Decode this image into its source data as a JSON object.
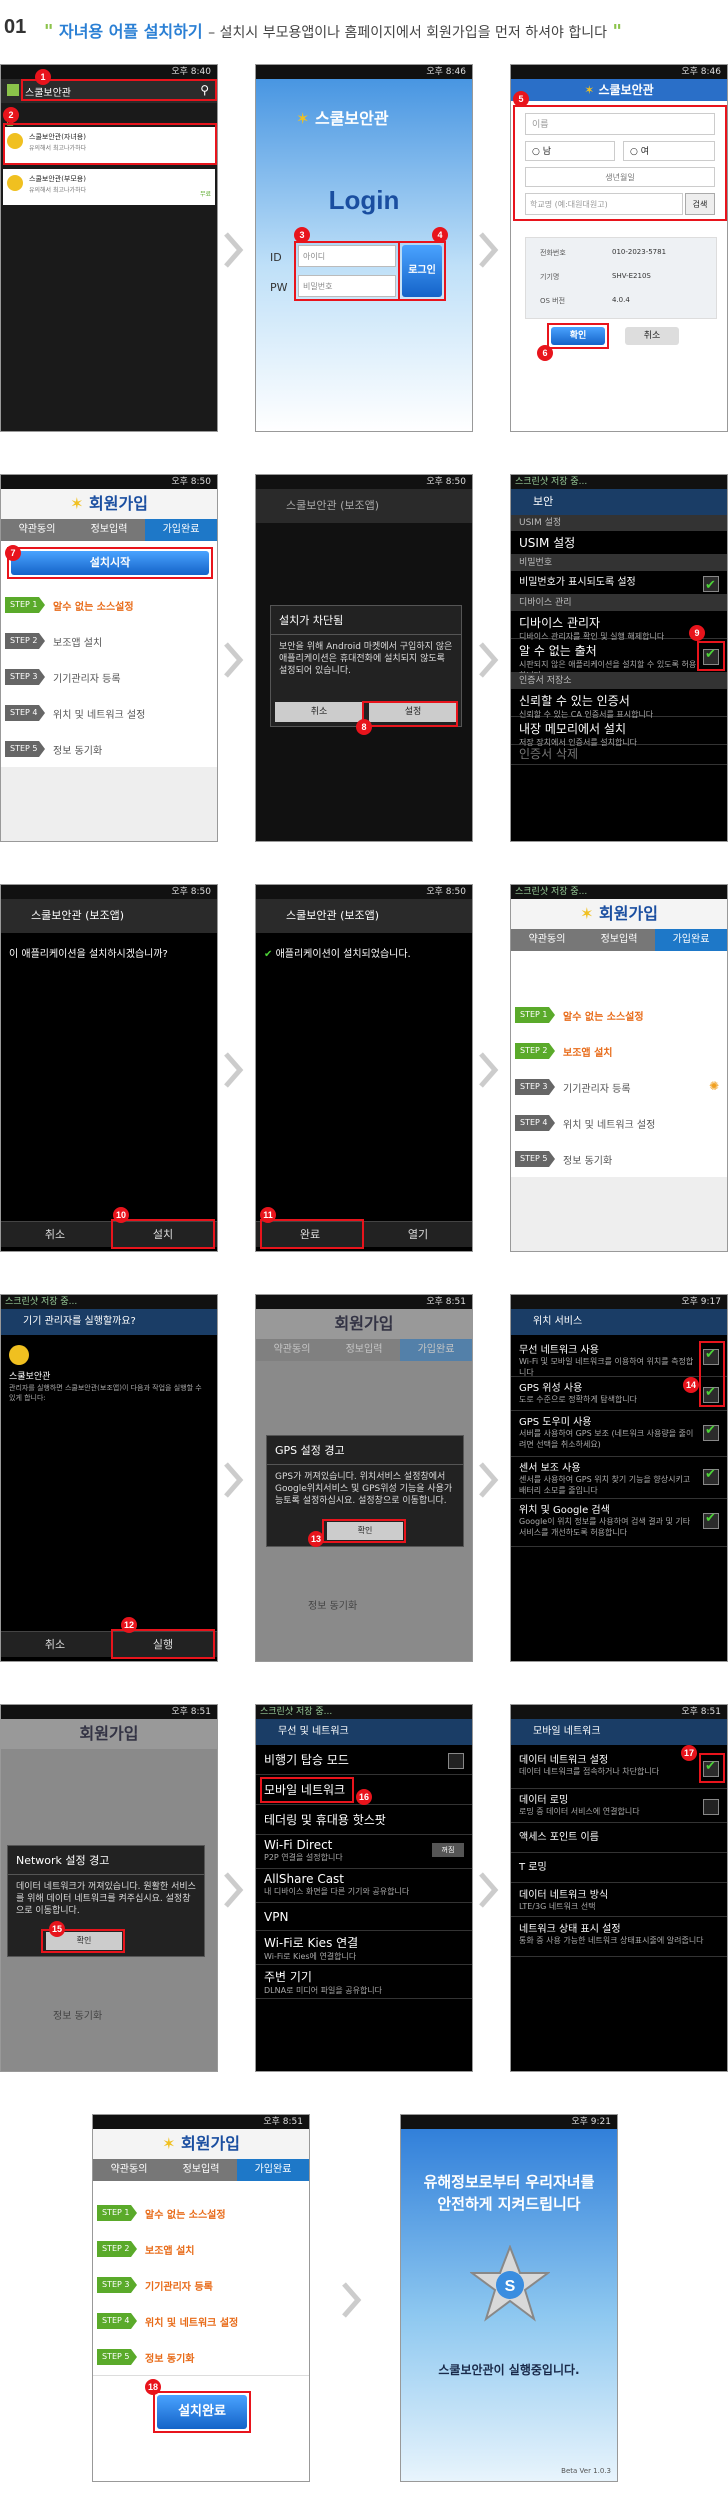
{
  "header": {
    "num": "01",
    "title": "자녀용 어플 설치하기",
    "sub": "– 설치시 부모용앱이나 홈페이지에서 회원가입을 먼저 하셔야 합니다"
  },
  "status": {
    "t1": "오후 8:40",
    "t2": "오후 8:46",
    "t3": "오후 8:46",
    "t4": "오후 8:50",
    "t5": "오후 8:50",
    "t6": "오후 8:50",
    "t7": "오후 8:50",
    "t8": "오후 8:50",
    "t9": "오후 8:51",
    "t10": "오후 8:51",
    "t11": "오후 9:17",
    "t12": "오후 8:51",
    "t13": "오후 8:51",
    "t14": "오후 8:51",
    "t15": "오후 9:21"
  },
  "screens": {
    "s1": {
      "search": "스쿨보안관",
      "section": "앱",
      "app1": "스쿨보안관(자녀용)",
      "app1_sub": "유의해서 최고나가하다",
      "app2": "스쿨보안관(부모용)",
      "app2_sub": "유의해서 최고나가하다",
      "free": "무료"
    },
    "s2": {
      "brand": "스쿨보안관",
      "login": "Login",
      "id_label": "ID",
      "pw_label": "PW",
      "id_ph": "아이디",
      "pw_ph": "비밀번호",
      "login_btn": "로그인"
    },
    "s3": {
      "brand": "스쿨보안관",
      "name_ph": "이름",
      "male": "남",
      "female": "여",
      "birth": "생년월일",
      "school_ph": "학교명  (예:대원대원고)",
      "search_btn": "검색",
      "phone_k": "전화번호",
      "phone_v": "010-2023-5781",
      "model_k": "기기명",
      "model_v": "SHV-E210S",
      "os_k": "OS 버전",
      "os_v": "4.0.4",
      "ok": "확인",
      "cancel": "취소"
    },
    "s4": {
      "title": "회원가입",
      "tabs": [
        "약관동의",
        "정보입력",
        "가입완료"
      ],
      "install_btn": "설치시작",
      "steps": [
        {
          "tag": "STEP 1",
          "label": "알수 없는 소스설정"
        },
        {
          "tag": "STEP 2",
          "label": "보조앱 설치"
        },
        {
          "tag": "STEP 3",
          "label": "기기관리자 등록"
        },
        {
          "tag": "STEP 4",
          "label": "위치 및 네트워크 설정"
        },
        {
          "tag": "STEP 5",
          "label": "정보 동기화"
        }
      ]
    },
    "s5": {
      "app": "스쿨보안관 (보조앱)",
      "dlg_title": "설치가 차단됨",
      "dlg_body": "보안을 위해 Android 마켓에서 구입하지 않은 애플리케이션은 휴대전화에 설치되지 않도록 설정되어 있습니다.",
      "cancel": "취소",
      "settings": "설정"
    },
    "s6": {
      "title": "보안",
      "usim_sec": "USIM 설정",
      "usim": "USIM 설정",
      "pw_sec": "비밀번호",
      "pw_show": "비밀번호가 표시되도록 설정",
      "dev_sec": "디바이스 관리",
      "dev_admin": "디바이스 관리자",
      "dev_admin_d": "디바이스 관리자를 확인 및 실행 해제합니다",
      "unknown": "알 수 없는 출처",
      "unknown_d": "시판되지 않은 애플리케이션을 설치할 수 있도록 허용합니다",
      "cred_sec": "인증서 저장소",
      "trusted": "신뢰할 수 있는 인증서",
      "trusted_d": "신뢰할 수 있는 CA 인증서를 표시합니다",
      "mem": "내장 메모리에서 설치",
      "mem_d": "저장 장치에서 인증서를 설치합니다",
      "del": "인증서 삭제"
    },
    "s7": {
      "app": "스쿨보안관 (보조앱)",
      "q": "이 애플리케이션을 설치하시겠습니까?",
      "cancel": "취소",
      "install": "설치"
    },
    "s8": {
      "app": "스쿨보안관 (보조앱)",
      "done_msg": "애플리케이션이 설치되었습니다.",
      "done": "완료",
      "open": "열기"
    },
    "s9": {
      "title": "회원가입",
      "tabs": [
        "약관동의",
        "정보입력",
        "가입완료"
      ]
    },
    "s10": {
      "title": "기기 관리자를 실행할까요?",
      "app": "스쿨보안관",
      "desc": "관리자를 실행하면 스쿨보안관(보조앱)이 다음과 작업을 실행할 수 있게 합니다:",
      "cancel": "취소",
      "run": "실행"
    },
    "s11": {
      "dlg_title": "GPS 설정 경고",
      "dlg_body": "GPS가 꺼져있습니다. 위치서비스 설정창에서 Google위치서비스 및 GPS위성 기능을 사용가능토록 설정하십시요. 설정창으로 이동합니다.",
      "ok": "확인",
      "step5": "정보 동기화"
    },
    "s12": {
      "title": "위치 서비스",
      "wifi": "무선 네트워크 사용",
      "wifi_d": "Wi-Fi 및 모바일 네트워크를 이용하여 위치를 측정합니다",
      "gps": "GPS 위성 사용",
      "gps_d": "도로 수준으로 정확하게 탐색합니다",
      "agps": "GPS 도우미 사용",
      "agps_d": "서버를 사용하여 GPS 보조 (네트워크 사용량을 줄이려면 선택을 취소하세요)",
      "sensor": "센서 보조 사용",
      "sensor_d": "센서를 사용하여 GPS 위치 찾기 기능을 향상시키고 배터리 소모를 줄입니다",
      "google": "위치 및 Google 검색",
      "google_d": "Google이 위치 정보를 사용하여 검색 결과 및 기타 서비스를 개선하도록 허용합니다"
    },
    "s13": {
      "dlg_title": "Network 설정 경고",
      "dlg_body": "데이터 네트워크가 꺼져있습니다. 원활한 서비스를 위해 데이터 네트워크를 켜주십시요. 설정창으로 이동합니다.",
      "ok": "확인",
      "step5": "정보 동기화"
    },
    "s14": {
      "title": "무선 및 네트워크",
      "air": "비행기 탑승 모드",
      "mobile": "모바일 네트워크",
      "tether": "테더링 및 휴대용 핫스팟",
      "wfd": "Wi-Fi Direct",
      "wfd_d": "P2P 연결을 설정합니다",
      "wfd_state": "꺼짐",
      "allshare": "AllShare Cast",
      "allshare_d": "내 디바이스 화면을 다른 기기와 공유합니다",
      "vpn": "VPN",
      "kies": "Wi-Fi로 Kies 연결",
      "kies_d": "Wi-Fi로 Kies에 연결합니다",
      "nearby": "주변 기기",
      "nearby_d": "DLNA로 미디어 파일을 공유합니다"
    },
    "s15": {
      "title": "모바일 네트워크",
      "data": "데이터 네트워크 설정",
      "data_d": "데이터 네트워크를 접속하거나 차단합니다",
      "roam": "데이터 로밍",
      "roam_d": "로밍 중 데이터 서비스에 연결합니다",
      "apn": "액세스 포인트 이름",
      "t": "T 로밍",
      "mode": "데이터 네트워크 방식",
      "mode_d": "LTE/3G 네트워크 선택",
      "status": "네트워크 상태 표시 설정",
      "status_d": "통화 중 사용 가능한 네트워크 상태표시줄에 알려줍니다"
    },
    "s16": {
      "title": "회원가입",
      "tabs": [
        "약관동의",
        "정보입력",
        "가입완료"
      ],
      "done_btn": "설치완료"
    },
    "s17": {
      "line1": "유해정보로부터 우리자녀를",
      "line2": "안전하게 지켜드립니다",
      "running": "스쿨보안관이 실행중입니다.",
      "ver": "Beta Ver 1.0.3"
    }
  },
  "badges": [
    "1",
    "2",
    "3",
    "4",
    "5",
    "6",
    "7",
    "8",
    "9",
    "10",
    "11",
    "12",
    "13",
    "14",
    "15",
    "16",
    "17",
    "18"
  ],
  "colors": {
    "accent": "#e8141c",
    "blue": "#1e78c8",
    "green": "#5aaa2a",
    "orange": "#e86c1a"
  }
}
